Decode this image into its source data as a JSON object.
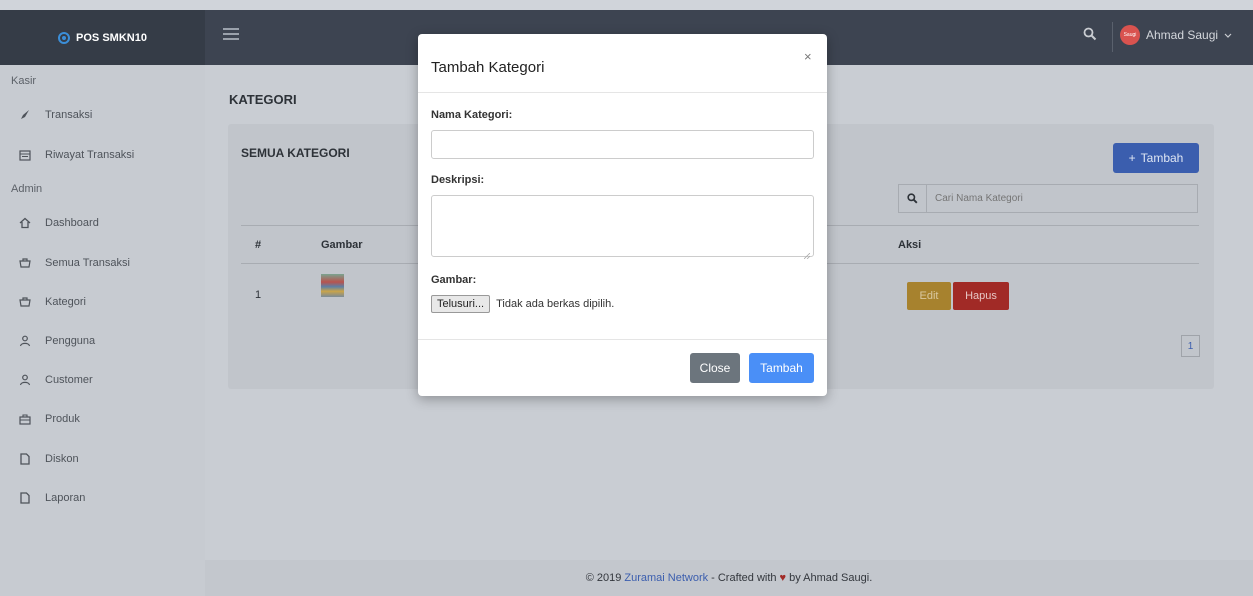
{
  "topbar": {
    "brand": "POS SMKN10",
    "user_name": "Ahmad Saugi",
    "avatar_text": "Saugi"
  },
  "sidebar": {
    "header_kasir": "Kasir",
    "header_admin": "Admin",
    "items": [
      {
        "label": "Transaksi",
        "icon": "rocket-icon"
      },
      {
        "label": "Riwayat Transaksi",
        "icon": "calendar-icon"
      },
      {
        "label": "Dashboard",
        "icon": "home-icon"
      },
      {
        "label": "Semua Transaksi",
        "icon": "cart-icon"
      },
      {
        "label": "Kategori",
        "icon": "cart-icon"
      },
      {
        "label": "Pengguna",
        "icon": "user-icon"
      },
      {
        "label": "Customer",
        "icon": "user-icon"
      },
      {
        "label": "Produk",
        "icon": "briefcase-icon"
      },
      {
        "label": "Diskon",
        "icon": "file-icon"
      },
      {
        "label": "Laporan",
        "icon": "file-icon"
      }
    ]
  },
  "main": {
    "page_title": "KATEGORI",
    "card_title": "SEMUA KATEGORI",
    "add_button": "Tambah",
    "search_placeholder": "Cari Nama Kategori",
    "columns": [
      "#",
      "Gambar",
      "Aksi"
    ],
    "rows": [
      {
        "no": "1",
        "edit_label": "Edit",
        "delete_label": "Hapus"
      }
    ],
    "pagination": "1"
  },
  "modal": {
    "title": "Tambah Kategori",
    "close_x": "×",
    "nama_label": "Nama Kategori:",
    "nama_value": "",
    "deskripsi_label": "Deskripsi:",
    "deskripsi_value": "",
    "gambar_label": "Gambar:",
    "file_button": "Telusuri...",
    "file_status": "Tidak ada berkas dipilih.",
    "close_button": "Close",
    "submit_button": "Tambah"
  },
  "footer": {
    "prefix": "© 2019",
    "link": "Zuramai Network",
    "middle": "- Crafted with",
    "suffix": "by Ahmad Saugi."
  }
}
